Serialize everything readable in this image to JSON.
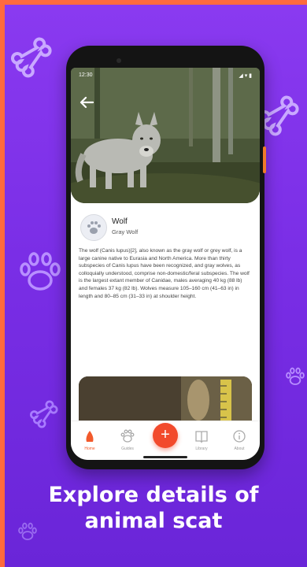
{
  "status_bar": {
    "time": "12:30",
    "icons": "◢ ▾ ▮"
  },
  "animal": {
    "name": "Wolf",
    "common_name": "Gray Wolf",
    "description": "The wolf (Canis lupus)[2], also known as the gray wolf or grey wolf, is a large canine native to Eurasia and North America. More than thirty subspecies of Canis lupus have been recognized, and gray wolves, as colloquially understood, comprise non-domestic/feral subspecies. The wolf is the largest extant member of Canidae, males averaging 40 kg (88 lb) and females 37 kg (82 lb). Wolves measure 105–160 cm (41–63 in) in length and 80–85 cm (31–33 in) at shoulder height."
  },
  "nav": {
    "items": [
      {
        "label": "Home",
        "icon": "home-icon",
        "active": true
      },
      {
        "label": "Guides",
        "icon": "paw-icon",
        "active": false
      },
      {
        "label": "Add",
        "icon": "plus-icon",
        "fab": true
      },
      {
        "label": "Library",
        "icon": "book-icon",
        "active": false
      },
      {
        "label": "About",
        "icon": "info-icon",
        "active": false
      }
    ]
  },
  "caption": {
    "line1": "Explore details of",
    "line2": "animal scat"
  },
  "colors": {
    "background": "#7a2ee6",
    "accent": "#f24a2c",
    "border": "#ff6a3d"
  }
}
